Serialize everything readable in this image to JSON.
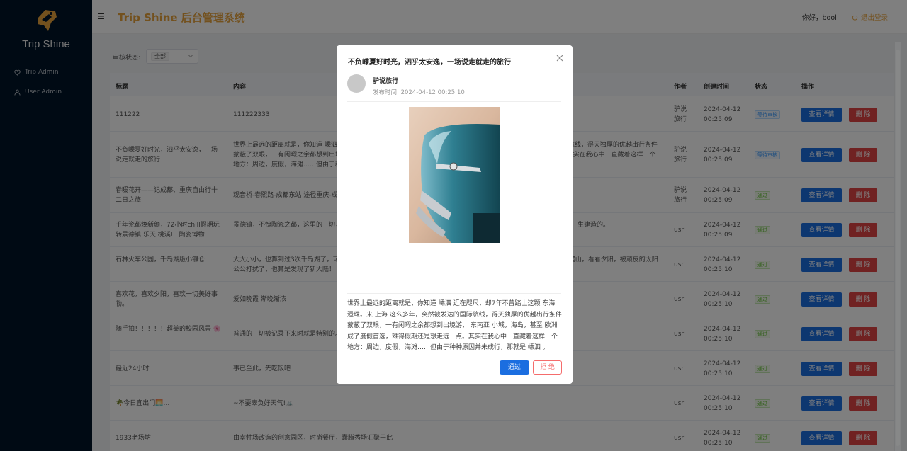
{
  "sidebar": {
    "brand": "Trip Shine",
    "items": [
      {
        "label": "Trip Admin",
        "icon": "heart-icon"
      },
      {
        "label": "User Admin",
        "icon": "user-icon"
      }
    ]
  },
  "header": {
    "system_title": "Trip Shine 后台管理系统",
    "greeting": "你好，bool",
    "logout": "退出登录"
  },
  "filter": {
    "label": "审核状态:",
    "selected": "全部"
  },
  "table": {
    "headers": {
      "title": "标题",
      "content": "内容",
      "author": "作者",
      "time": "创建时间",
      "status": "状态",
      "actions": "操作"
    },
    "detail_label": "查看详情",
    "delete_label": "删 除",
    "rows": [
      {
        "title": "111222",
        "content": "111222333",
        "author": "驴说旅行",
        "time": "2024-04-12 00:25:09",
        "status": "等待审核",
        "status_type": "pending"
      },
      {
        "title": "不负嵊夏好时光，泗乎太安逸，一场说走就走的旅行",
        "content": "世界上最远的距离就是，你知道 嵊泗 近在咫尺，却7年不曾踏上这颗 东海 遗珠。来 上海 这么多年，突然被发达的国际航线，得天独厚的优越出行条件蒙蔽了双眼，一有闲暇之余都想到出境游， 东南亚 小城，海岛，甚至 欧洲 成了度假首选，难得假期还是想走远一点。其实在我心中一直藏着这样一个地方：周边，度假，海滩……但由于种种原因并未成行，那就是 嵊泗 。",
        "author": "驴说旅行",
        "time": "2024-04-12 00:25:09",
        "status": "等待审核",
        "status_type": "pending"
      },
      {
        "title": "春暖花开——记成都、重庆自由行十二日之旅",
        "content": "观音桥-春熙路-成都东站 途径重庆-成都",
        "author": "驴说旅行",
        "time": "2024-04-12 00:25:09",
        "status": "通过",
        "status_type": "passed"
      },
      {
        "title": "千年瓷都焕新颜，72小时chill假期玩转景德镇 乐天 桃溪川 陶瓷博物馆……",
        "content": "景德镇，不愧陶瓷之都，这里的一切，都与陶瓷有关。在这里我们遇见了一位八旬的老奶奶，她是一位八旬的老奶奶倾其一生建造的。",
        "author": "usr",
        "time": "2024-04-12 00:25:09",
        "status": "通过",
        "status_type": "passed"
      },
      {
        "title": "石林火车公园，千岛湖版小镰仓",
        "content": "大大小小，也算到过3次千岛湖了，可每次都只是匆匆一瞥，这次终于有时间好好逛逛了。第一站是游游船，登登岛，爬爬山，看看夕阳，被顽皮的太阳公公打扰了，也算是发现了新大陆！",
        "author": "usr",
        "time": "2024-04-12 00:25:10",
        "status": "通过",
        "status_type": "passed"
      },
      {
        "title": "喜欢花，喜欢夕阳，喜欢一切美好事物。",
        "content": "爱如晚霞 渐晚渐浓",
        "author": "usr",
        "time": "2024-04-12 00:25:10",
        "status": "通过",
        "status_type": "passed"
      },
      {
        "title": "随手拍！！！！！超美的校园风景 🌸",
        "content": "普通的一切被记录下来时就是特别的。每一个角落都有它的故事，用镜头记录下美好的校园，这些都是我的回忆 🌸 ……",
        "author": "usr",
        "time": "2024-04-12 00:25:10",
        "status": "通过",
        "status_type": "passed"
      },
      {
        "title": "最近24小时",
        "content": "事已至此，先吃饭吧",
        "author": "usr",
        "time": "2024-04-12 00:25:10",
        "status": "通过",
        "status_type": "passed"
      },
      {
        "title": "🌴今日宜出门🌅…",
        "content": "~不要辜负好天气!🚲",
        "author": "usr",
        "time": "2024-04-12 00:25:10",
        "status": "通过",
        "status_type": "passed"
      },
      {
        "title": "1933老场坊",
        "content": "由宰牲场改造的创意园区，时尚餐厅，囊腾秀场汇聚于此",
        "author": "usr",
        "time": "2024-04-12 00:25:10",
        "status": "通过",
        "status_type": "passed"
      }
    ]
  },
  "modal": {
    "title": "不负嵊夏好时光，泗乎太安逸，一场说走就走的旅行",
    "author": "驴说旅行",
    "published": "发布时间: 2024-04-12 00:25:10",
    "content": "世界上最远的距离就是，你知道 嵊泗 近在咫尺，却7年不曾踏上这颗 东海 遗珠。来 上海 这么多年，突然被发达的国际航线，得天独厚的优越出行条件蒙蔽了双眼，一有闲暇之余都想到出境游， 东南亚 小城，海岛，甚至 欧洲 成了度假首选，难得假期还是想走远一点。其实在我心中一直藏着这样一个地方：周边，度假，海滩……但由于种种原因并未成行，那就是 嵊泗 。",
    "pass_label": "通过",
    "reject_label": "拒 绝"
  },
  "colors": {
    "sidebar_bg": "#001529",
    "accent": "#e6a23c",
    "primary": "#1b6ee0",
    "danger": "#e04444"
  }
}
